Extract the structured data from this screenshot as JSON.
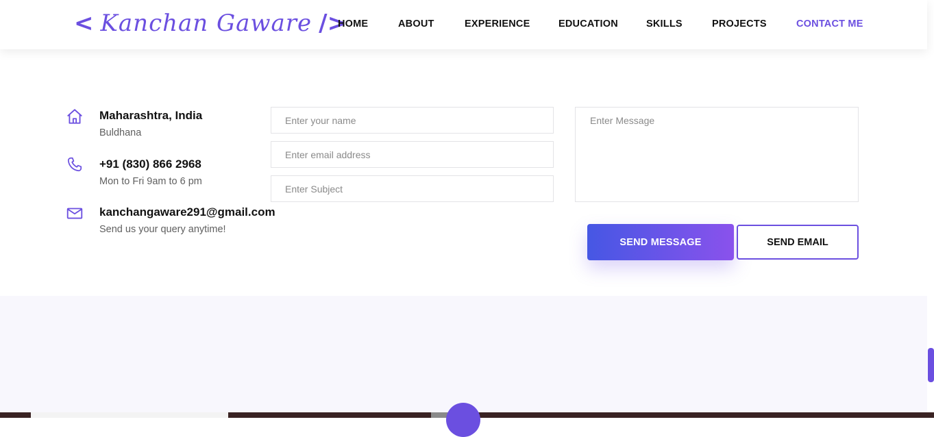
{
  "header": {
    "logo_open": "<",
    "logo_name": "Kanchan Gaware",
    "logo_close": "/>",
    "nav": [
      {
        "label": "HOME"
      },
      {
        "label": "ABOUT"
      },
      {
        "label": "EXPERIENCE"
      },
      {
        "label": "EDUCATION"
      },
      {
        "label": "SKILLS"
      },
      {
        "label": "PROJECTS"
      },
      {
        "label": "CONTACT ME",
        "active": true
      }
    ]
  },
  "contact_info": [
    {
      "icon": "home-icon",
      "title": "Maharashtra, India",
      "subtitle": "Buldhana"
    },
    {
      "icon": "phone-icon",
      "title": "+91 (830) 866 2968",
      "subtitle": "Mon to Fri 9am to 6 pm"
    },
    {
      "icon": "mail-icon",
      "title": "kanchangaware291@gmail.com",
      "subtitle": "Send us your query anytime!"
    }
  ],
  "form": {
    "name_placeholder": "Enter your name",
    "email_placeholder": "Enter email address",
    "subject_placeholder": "Enter Subject",
    "message_placeholder": "Enter Message",
    "send_message_label": "SEND MESSAGE",
    "send_email_label": "SEND EMAIL"
  },
  "colors": {
    "accent": "#6b4fe0",
    "gradient_start": "#4657e4",
    "gradient_end": "#8a52ec",
    "lower_section_bg": "#f8f7fd"
  }
}
